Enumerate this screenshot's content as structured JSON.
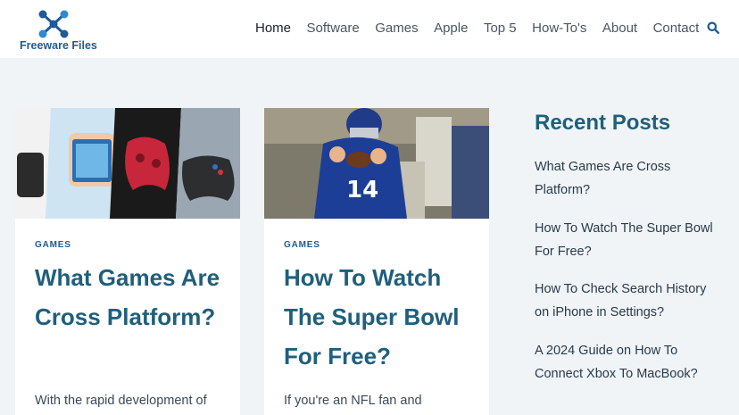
{
  "brand": {
    "logo_text": "Freeware Files"
  },
  "nav": {
    "items": [
      {
        "label": "Home"
      },
      {
        "label": "Software"
      },
      {
        "label": "Games"
      },
      {
        "label": "Apple"
      },
      {
        "label": "Top 5"
      },
      {
        "label": "How-To's"
      },
      {
        "label": "About"
      },
      {
        "label": "Contact"
      }
    ]
  },
  "posts": [
    {
      "category": "GAMES",
      "title": "What Games Are Cross Platform?",
      "excerpt": "With the rapid development of"
    },
    {
      "category": "GAMES",
      "title": "How To Watch The Super Bowl For Free?",
      "excerpt": "If you're an NFL fan and"
    }
  ],
  "sidebar": {
    "heading": "Recent Posts",
    "items": [
      {
        "label": "What Games Are Cross Platform?"
      },
      {
        "label": "How To Watch The Super Bowl For Free?"
      },
      {
        "label": "How To Check Search History on iPhone in Settings?"
      },
      {
        "label": "A 2024 Guide on How To Connect Xbox To MacBook?"
      }
    ]
  },
  "colors": {
    "brand": "#1f5b97",
    "heading": "#1f5f7d",
    "page_bg": "#f0f4f7"
  }
}
